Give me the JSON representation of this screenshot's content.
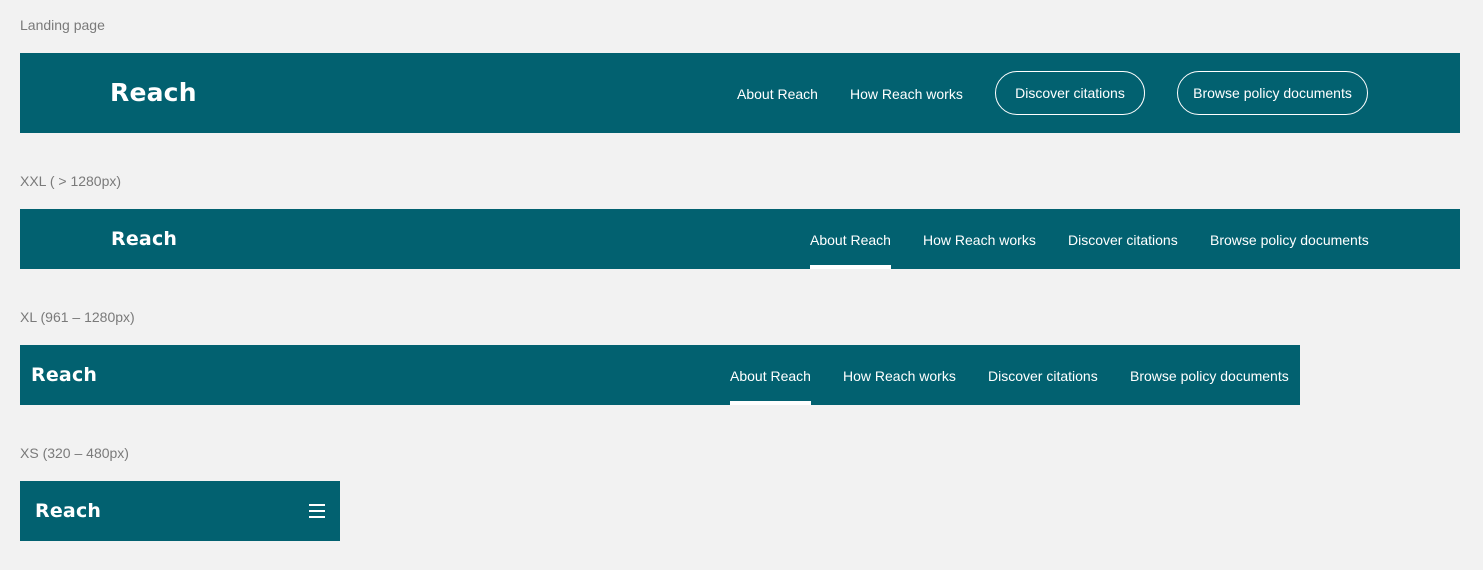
{
  "sections": {
    "landing": {
      "label": "Landing page",
      "brand": "Reach",
      "nav": [
        "About Reach",
        "How Reach works"
      ],
      "pills": [
        "Discover citations",
        "Browse policy documents"
      ]
    },
    "xxl": {
      "label": "XXL ( > 1280px)",
      "brand": "Reach",
      "nav": [
        "About Reach",
        "How Reach works",
        "Discover citations",
        "Browse policy documents"
      ],
      "active": "About Reach"
    },
    "xl": {
      "label": "XL (961 – 1280px)",
      "brand": "Reach",
      "nav": [
        "About Reach",
        "How Reach works",
        "Discover citations",
        "Browse policy documents"
      ],
      "active": "About Reach"
    },
    "xs": {
      "label": "XS (320 – 480px)",
      "brand": "Reach",
      "menu_icon": "hamburger-menu-icon"
    }
  },
  "colors": {
    "background": "#f2f2f2",
    "navbar": "#026170",
    "text_on_navbar": "#ffffff",
    "label": "#7a7a7a"
  }
}
